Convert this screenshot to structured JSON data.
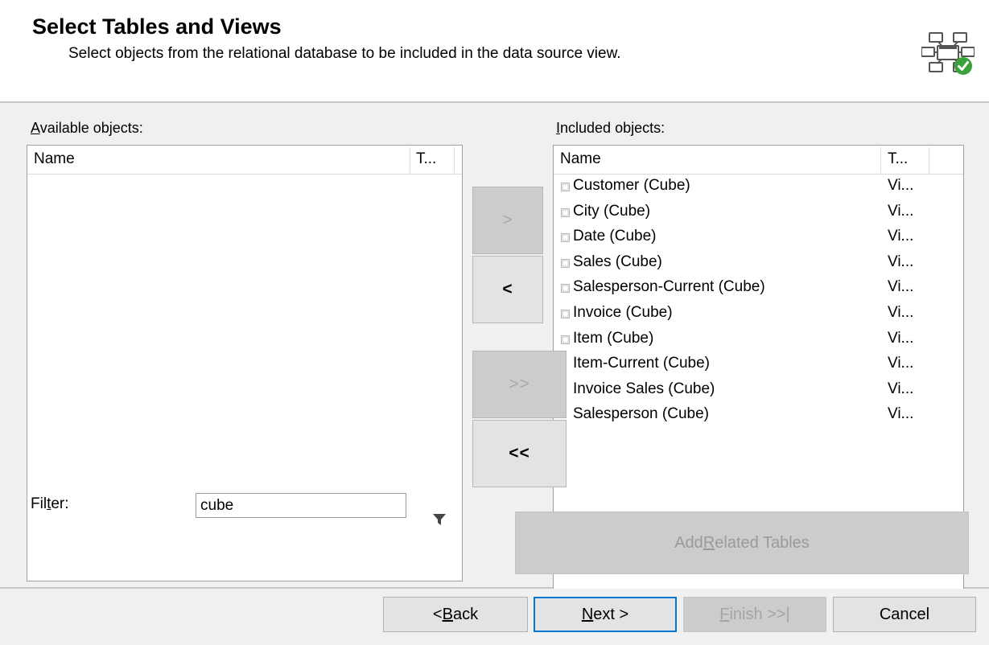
{
  "header": {
    "title": "Select Tables and Views",
    "subtitle": "Select objects from the relational database to be included in the data source view.",
    "icon": "data-source-view-diagram-icon",
    "icon_status": "checkmark-ok"
  },
  "available_panel": {
    "label_prefix": "",
    "label_accel": "A",
    "label_rest": "vailable objects:",
    "columns": {
      "name": "Name",
      "type": "T..."
    },
    "rows": []
  },
  "included_panel": {
    "label_accel": "I",
    "label_rest": "ncluded objects:",
    "columns": {
      "name": "Name",
      "type": "T..."
    },
    "rows": [
      {
        "name": "Customer (Cube)",
        "type": "Vi...",
        "has_icon": true
      },
      {
        "name": "City (Cube)",
        "type": "Vi...",
        "has_icon": true
      },
      {
        "name": "Date (Cube)",
        "type": "Vi...",
        "has_icon": true
      },
      {
        "name": "Sales (Cube)",
        "type": "Vi...",
        "has_icon": true
      },
      {
        "name": "Salesperson-Current (Cube)",
        "type": "Vi...",
        "has_icon": true
      },
      {
        "name": "Invoice (Cube)",
        "type": "Vi...",
        "has_icon": true
      },
      {
        "name": "Item (Cube)",
        "type": "Vi...",
        "has_icon": true
      },
      {
        "name": "Item-Current (Cube)",
        "type": "Vi...",
        "has_icon": false
      },
      {
        "name": "Invoice Sales (Cube)",
        "type": "Vi...",
        "has_icon": false
      },
      {
        "name": "Salesperson (Cube)",
        "type": "Vi...",
        "has_icon": false
      }
    ]
  },
  "transfer_buttons": {
    "add_one": {
      "label": ">",
      "enabled": false
    },
    "remove_one": {
      "label": "<",
      "enabled": true
    },
    "add_all": {
      "label": ">>",
      "enabled": false
    },
    "remove_all": {
      "label": "<<",
      "enabled": true
    }
  },
  "filter": {
    "label_pre": "Fil",
    "label_accel": "t",
    "label_post": "er:",
    "value": "cube",
    "placeholder": "",
    "icon": "funnel-filter-icon"
  },
  "add_related": {
    "label_pre": "Add ",
    "label_accel": "R",
    "label_post": "elated Tables",
    "enabled": false
  },
  "footer": {
    "back": {
      "pre": "< ",
      "accel": "B",
      "post": "ack",
      "enabled": true,
      "focused": false
    },
    "next": {
      "pre": "",
      "accel": "N",
      "post": "ext >",
      "enabled": true,
      "focused": true
    },
    "finish": {
      "pre": "",
      "accel": "F",
      "post": "inish >>|",
      "enabled": false,
      "focused": false
    },
    "cancel": {
      "pre": "",
      "accel": "",
      "post": "Cancel",
      "enabled": true,
      "focused": false
    }
  },
  "colors": {
    "background": "#f0f0f0",
    "accent_focus": "#0078d7",
    "check_green": "#3aa23a",
    "disabled_text": "#a8a8a8"
  }
}
